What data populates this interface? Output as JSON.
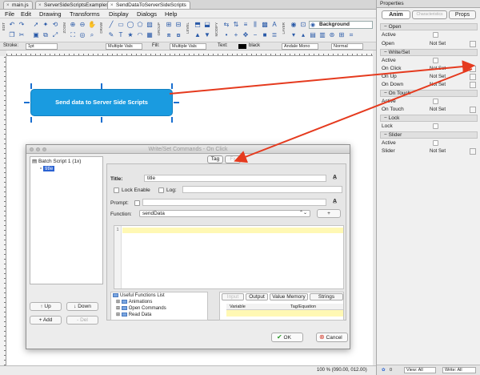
{
  "file_tabs": [
    {
      "label": "main.js",
      "active": false
    },
    {
      "label": "ServerSideScriptsExamples",
      "active": false
    },
    {
      "label": "SendDataToServerSideScripts",
      "active": true
    }
  ],
  "menu": [
    "File",
    "Edit",
    "Drawing",
    "Transforms",
    "Display",
    "Dialogs",
    "Help"
  ],
  "toolbar": {
    "group_labels": [
      "EDIT",
      "ZOOM",
      "DRAW",
      "GROUP",
      "LEVEL",
      "MODIFY",
      "LAYER"
    ],
    "background_label": "Background"
  },
  "property_bar": {
    "stroke_label": "Stroke:",
    "stroke_value": "1pt",
    "multiple_vals_1": "Multiple Vals",
    "fill_label": "Fill:",
    "multiple_vals_2": "Multiple Vals",
    "text_label": "Text:",
    "text_color_value": "black",
    "font_value": "Andale Mono",
    "style_value": "Normal"
  },
  "stage": {
    "button_label": "Send data to Server Side Scripts"
  },
  "status": {
    "zoom": "100 % (090.00, 012.00)"
  },
  "properties": {
    "panel_title": "Properties",
    "tabs": [
      "Anim",
      "Characteristics",
      "Props"
    ],
    "sections": [
      {
        "title": "Open",
        "rows": [
          {
            "label": "Active",
            "value": ""
          },
          {
            "label": "Open",
            "value": "Not Set"
          }
        ]
      },
      {
        "title": "Write/Set",
        "rows": [
          {
            "label": "Active",
            "value": ""
          },
          {
            "label": "On Click",
            "value": "Not Set"
          },
          {
            "label": "On Up",
            "value": "Not Set"
          },
          {
            "label": "On Down",
            "value": "Not Set"
          }
        ]
      },
      {
        "title": "On Touch",
        "rows": [
          {
            "label": "Active",
            "value": ""
          },
          {
            "label": "On Touch",
            "value": "Not Set"
          }
        ]
      },
      {
        "title": "Lock",
        "rows": [
          {
            "label": "Lock",
            "value": ""
          }
        ]
      },
      {
        "title": "Slider",
        "rows": [
          {
            "label": "Active",
            "value": ""
          },
          {
            "label": "Slider",
            "value": "Not Set"
          }
        ]
      }
    ],
    "footer": {
      "count": "0",
      "view_label": "View: All",
      "write_label": "Write: All"
    }
  },
  "dialog": {
    "title": "Write/Set Commands - On Click",
    "tree_root": "Batch Script 1 (1x)",
    "tree_child": "title",
    "content_tabs": [
      "Tag",
      "Fx"
    ],
    "title_label": "Title:",
    "title_value": "title",
    "lock_enable_label": "Lock Enable",
    "log_label": "Log:",
    "prompt_label": "Prompt:",
    "function_label": "Function:",
    "function_value": "sendData",
    "add_function": "+",
    "line_number": "1",
    "functions_list": [
      "Useful Functions List",
      "Animations",
      "Open Commands",
      "Read Data"
    ],
    "var_tabs": [
      "Input",
      "Output",
      "Value Memory",
      "Strings"
    ],
    "var_headers": [
      "Variable",
      "Tag/Equation"
    ],
    "up_button": "↑ Up",
    "down_button": "↓ Down",
    "add_button": "+ Add",
    "del_button": "- Del",
    "ok_button": "OK",
    "cancel_button": "Cancel"
  },
  "colors": {
    "stage_button": "#1a9be0",
    "annotation_arrow": "#e53a1e",
    "selection": "#2a62d2"
  }
}
